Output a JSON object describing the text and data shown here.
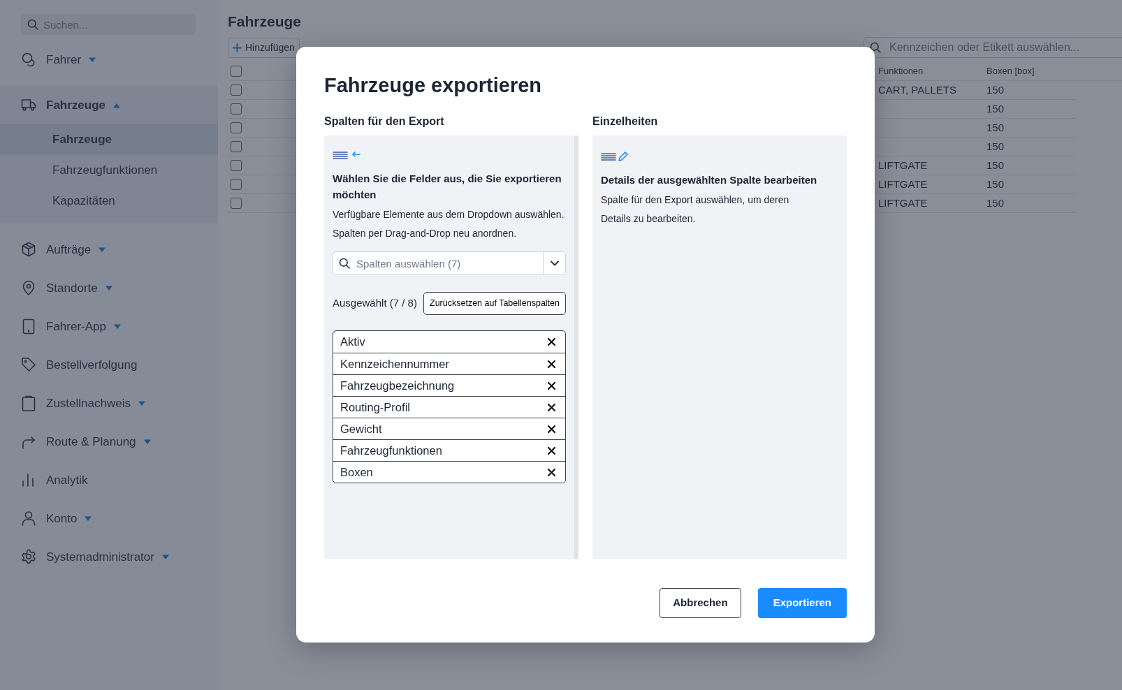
{
  "sidebar": {
    "search": {
      "placeholder": "Suchen..."
    },
    "items": [
      {
        "label": "Fahrer",
        "kind": "group",
        "expanded": false
      },
      {
        "label": "Fahrzeuge",
        "kind": "group",
        "expanded": true,
        "children": [
          {
            "label": "Fahrzeuge",
            "selected": true
          },
          {
            "label": "Fahrzeugfunktionen",
            "selected": false
          },
          {
            "label": "Kapazitäten",
            "selected": false
          }
        ]
      },
      {
        "label": "Aufträge",
        "kind": "group",
        "expanded": false
      },
      {
        "label": "Standorte",
        "kind": "group",
        "expanded": false
      },
      {
        "label": "Fahrer-App",
        "kind": "group",
        "expanded": false
      },
      {
        "label": "Bestellverfolgung",
        "kind": "link"
      },
      {
        "label": "Zustellnachweis",
        "kind": "group",
        "expanded": false
      },
      {
        "label": "Route & Planung",
        "kind": "group",
        "expanded": false
      },
      {
        "label": "Analytik",
        "kind": "link"
      },
      {
        "label": "Konto",
        "kind": "group",
        "expanded": false
      },
      {
        "label": "Systemadministrator",
        "kind": "group",
        "expanded": false
      }
    ]
  },
  "main": {
    "title": "Fahrzeuge",
    "add_button": "Hinzufügen",
    "search": {
      "placeholder": "Kennzeichen oder Etikett auswählen..."
    },
    "table": {
      "select_all_checked": false,
      "columns": [
        "Funktionen",
        "Boxen [box]"
      ],
      "rows": [
        {
          "checked": false,
          "functions": "CART, PALLETS",
          "boxes": "150"
        },
        {
          "checked": false,
          "boxes": "150"
        },
        {
          "checked": false,
          "boxes": "150"
        },
        {
          "checked": false,
          "boxes": "150"
        },
        {
          "checked": false,
          "functions": "LIFTGATE",
          "boxes": "150"
        },
        {
          "checked": false,
          "functions": "LIFTGATE",
          "boxes": "150"
        },
        {
          "checked": false,
          "functions": "LIFTGATE",
          "boxes": "150"
        }
      ]
    }
  },
  "modal": {
    "title": "Fahrzeuge exportieren",
    "left": {
      "label": "Spalten für den Export",
      "heading": "Wählen Sie die Felder aus, die Sie exportieren möchten",
      "lines": [
        "Verfügbare Elemente aus dem Dropdown auswählen.",
        "Spalten per Drag-and-Drop neu anordnen."
      ],
      "search": {
        "placeholder": "Spalten auswählen (7)"
      },
      "selected_label": "Ausgewählt (7 / 8)",
      "reset_button": "Zurücksetzen auf Tabellenspalten",
      "columns": [
        "Aktiv",
        "Kennzeichennummer",
        "Fahrzeugbezeichnung",
        "Routing-Profil",
        "Gewicht",
        "Fahrzeugfunktionen",
        "Boxen"
      ]
    },
    "right": {
      "label": "Einzelheiten",
      "heading": "Details der ausgewählten Spalte bearbeiten",
      "text": "Spalte für den Export auswählen, um deren Details zu bearbeiten."
    },
    "buttons": {
      "cancel": "Abbrechen",
      "submit": "Exportieren"
    }
  }
}
